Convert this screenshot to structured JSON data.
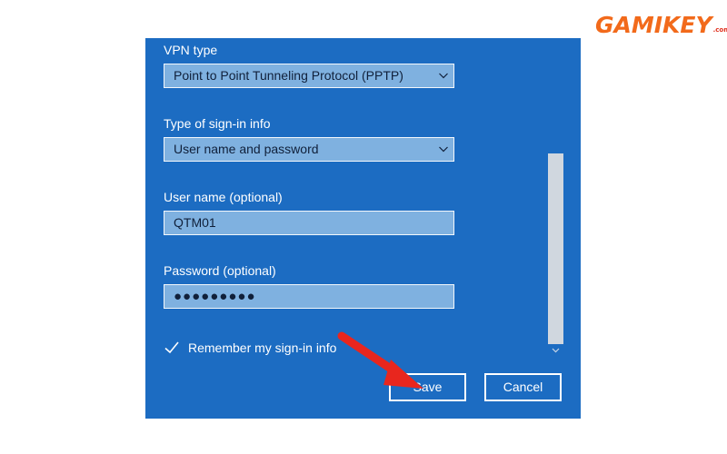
{
  "brand": {
    "logo_text": "GAMIKEY",
    "logo_suffix": ".com",
    "color": "#f26a1b"
  },
  "dialog": {
    "background": "#1c6cc2",
    "fields": {
      "vpn_type": {
        "label": "VPN type",
        "value": "Point to Point Tunneling Protocol (PPTP)"
      },
      "signin_type": {
        "label": "Type of sign-in info",
        "value": "User name and password"
      },
      "username": {
        "label": "User name (optional)",
        "value": "QTM01"
      },
      "password": {
        "label": "Password (optional)",
        "value": "●●●●●●●●●"
      }
    },
    "remember": {
      "label": "Remember my sign-in info",
      "checked": true
    },
    "buttons": {
      "save": "Save",
      "cancel": "Cancel"
    }
  },
  "annotation": {
    "arrow_color": "#e8261e",
    "icon": "red-arrow-icon"
  }
}
